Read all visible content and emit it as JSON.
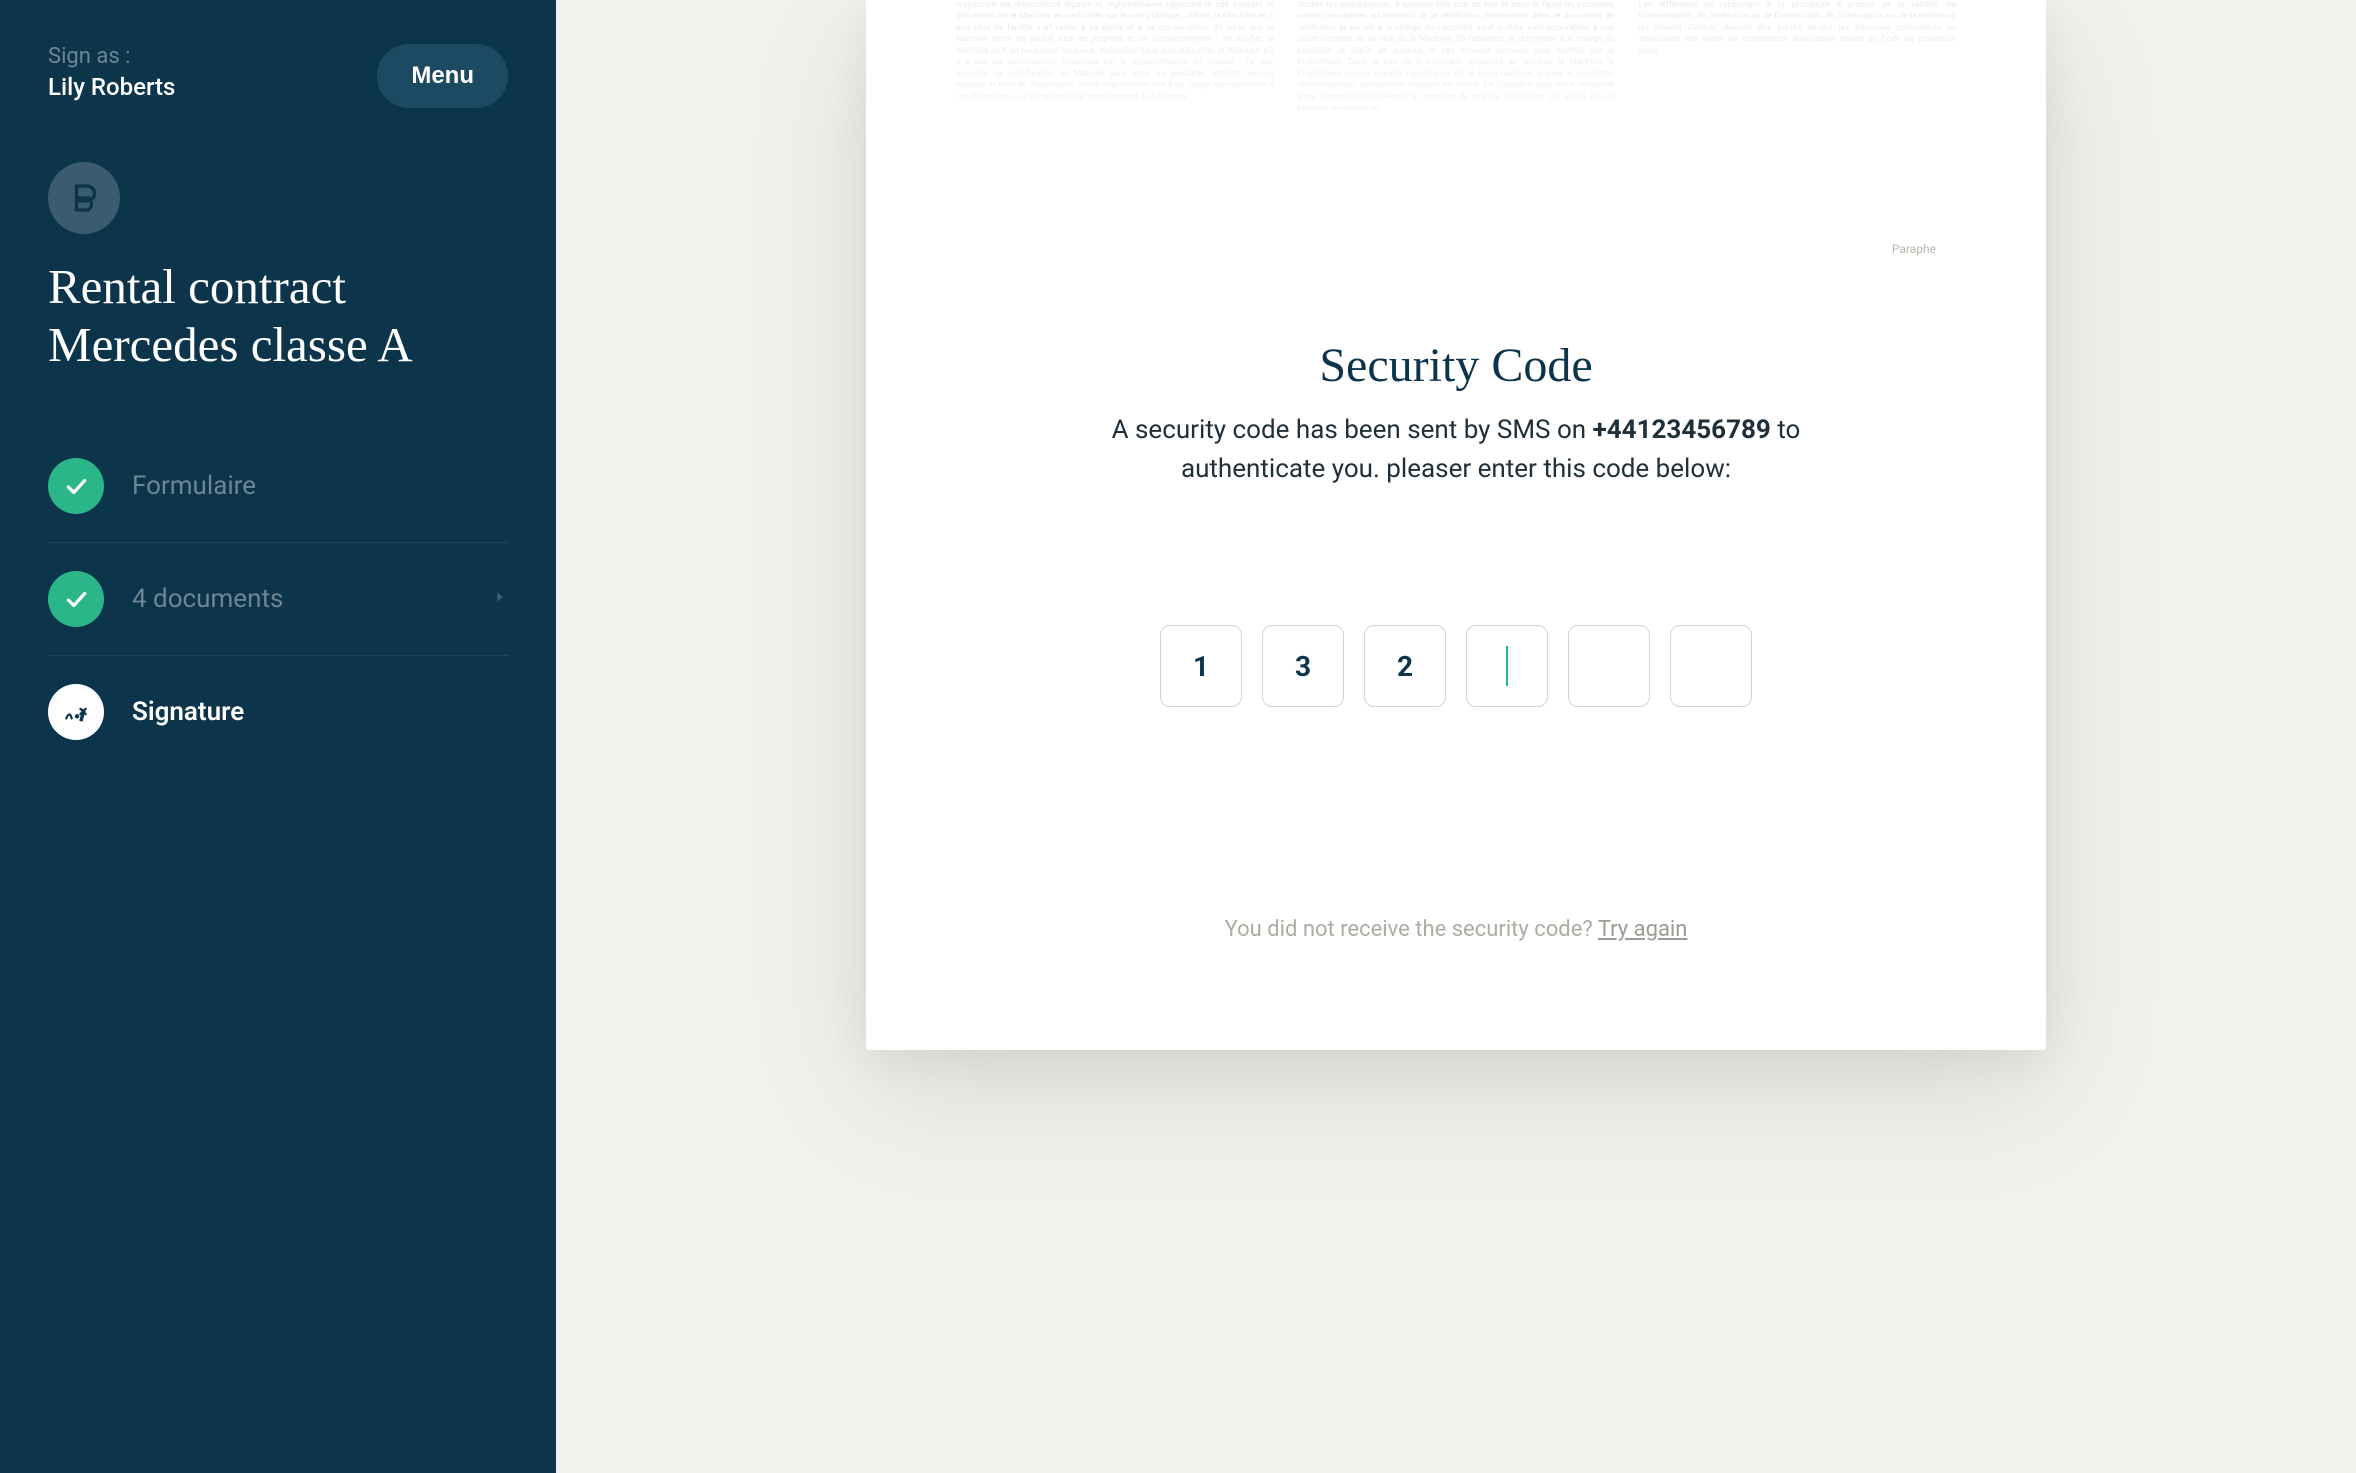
{
  "sidebar": {
    "sign_as_label": "Sign as :",
    "sign_as_name": "Lily Roberts",
    "menu_label": "Menu",
    "title_line1": "Rental contract",
    "title_line2": "Mercedes classe A",
    "steps": [
      {
        "label": "Formulaire",
        "state": "done"
      },
      {
        "label": "4 documents",
        "state": "done",
        "has_chevron": true
      },
      {
        "label": "Signature",
        "state": "active"
      }
    ]
  },
  "doc_preview": {
    "paraphe_label": "Paraphe",
    "col1": "respectant les dispositions légales et réglementaires régissant le cas échéant la circulation de la Machine en particulier sur la voie publique ; utiliser la Machine en « bon père de famille » et veiller à sa garde et à sa conservation, de sorte que la Machine reste en parfait état de propreté et de fonctionnement ; ne confier la Machine qu'à un personnel soigneux, spécialisé dans son utilisation et détenant s'il y a lieu les autorisations imposées par la réglementation en vigueur ; ne pas apporter de modification au Matériel sans avoir au préalable sollicité l'accord express et écrit du Propriétaire. Toute dépréciation liée à un usage non-conforme à ces directives, ou à un quelconque manquement du Locataire",
    "col2": "Toutes les dégradations, à quelque titre que ce soit et sans la faute du Locataire, seront constatées au moment de la restitution, notamment dans le document de restitution et seront à la charge du Locataire sauf si elles sont imputables à une usure normale ou un vice de la Machine. En l'absence de dommage à la charge du Locataire le dépôt de garantie le cas échéant convenu sera restitué par le Propriétaire. Dans le cas où le Locataire refuserait de restituer la Machine, le Propriétaire pourra requérir l'assistance de la force publique auprès la juridiction territorialement compétente statuant en référé. Le Locataire sera alors redevable d'une indemnité équivalente au montant du prix de la location qui aurait été dû pendant la période où",
    "col3": "Les différends se rapportant à la procédure à propos de la validité, de l'interprétation, de l'exécution ou de l'inexécution, de l'interruption ou de la résiliation du présent Contrat, devront être portés devant les tribunaux compétents en application des règles de compétence applicables issues du Code de procédure civile."
  },
  "security": {
    "title": "Security Code",
    "desc_pre": "A security code has been sent by SMS on ",
    "phone": "+44123456789",
    "desc_post": " to authenticate you. pleaser enter this code below:",
    "digits": [
      "1",
      "3",
      "2",
      "",
      "",
      ""
    ],
    "cursor_index": 3,
    "resend_text": "You did not receive the security code? ",
    "resend_action": "Try again"
  }
}
